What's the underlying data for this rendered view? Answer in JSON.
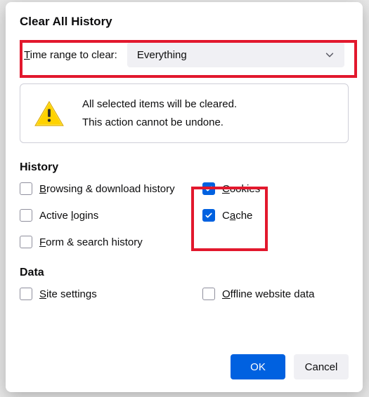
{
  "dialog": {
    "title": "Clear All History",
    "range_label_pre": "T",
    "range_label_post": "ime range to clear:",
    "range_value": "Everything",
    "info_line1": "All selected items will be cleared.",
    "info_line2": "This action cannot be undone."
  },
  "sections": {
    "history_title": "History",
    "data_title": "Data"
  },
  "checks": {
    "browsing": {
      "u": "B",
      "rest": "rowsing & download history",
      "checked": false
    },
    "cookies": {
      "u": "C",
      "rest": "ookies",
      "checked": true
    },
    "logins": {
      "pre": "Active ",
      "u": "l",
      "rest": "ogins",
      "checked": false
    },
    "cache": {
      "pre": "C",
      "u": "a",
      "rest": "che",
      "checked": true
    },
    "form": {
      "u": "F",
      "rest": "orm & search history",
      "checked": false
    },
    "site": {
      "u": "S",
      "rest": "ite settings",
      "checked": false
    },
    "offline": {
      "u": "O",
      "rest": "ffline website data",
      "checked": false
    }
  },
  "buttons": {
    "ok": "OK",
    "cancel": "Cancel"
  }
}
